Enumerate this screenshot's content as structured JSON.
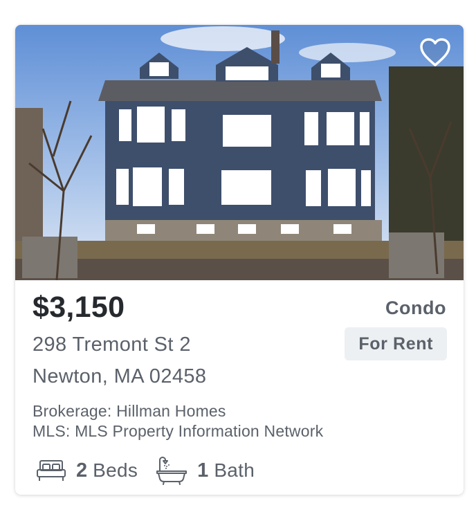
{
  "listing": {
    "price": "$3,150",
    "property_type": "Condo",
    "status": "For Rent",
    "address_line1": "298 Tremont St 2",
    "address_line2": "Newton, MA 02458",
    "brokerage": "Brokerage: Hillman Homes",
    "mls": "MLS: MLS Property Information Network",
    "beds_count": "2",
    "beds_label": "Beds",
    "baths_count": "1",
    "baths_label": "Bath",
    "photo_icon": "house-photo",
    "favorite_icon": "heart-outline-icon"
  },
  "colors": {
    "price_text": "#26292e",
    "secondary_text": "#5b616a",
    "status_bg": "#edf0f3",
    "house_siding": "#3e4f6c"
  }
}
